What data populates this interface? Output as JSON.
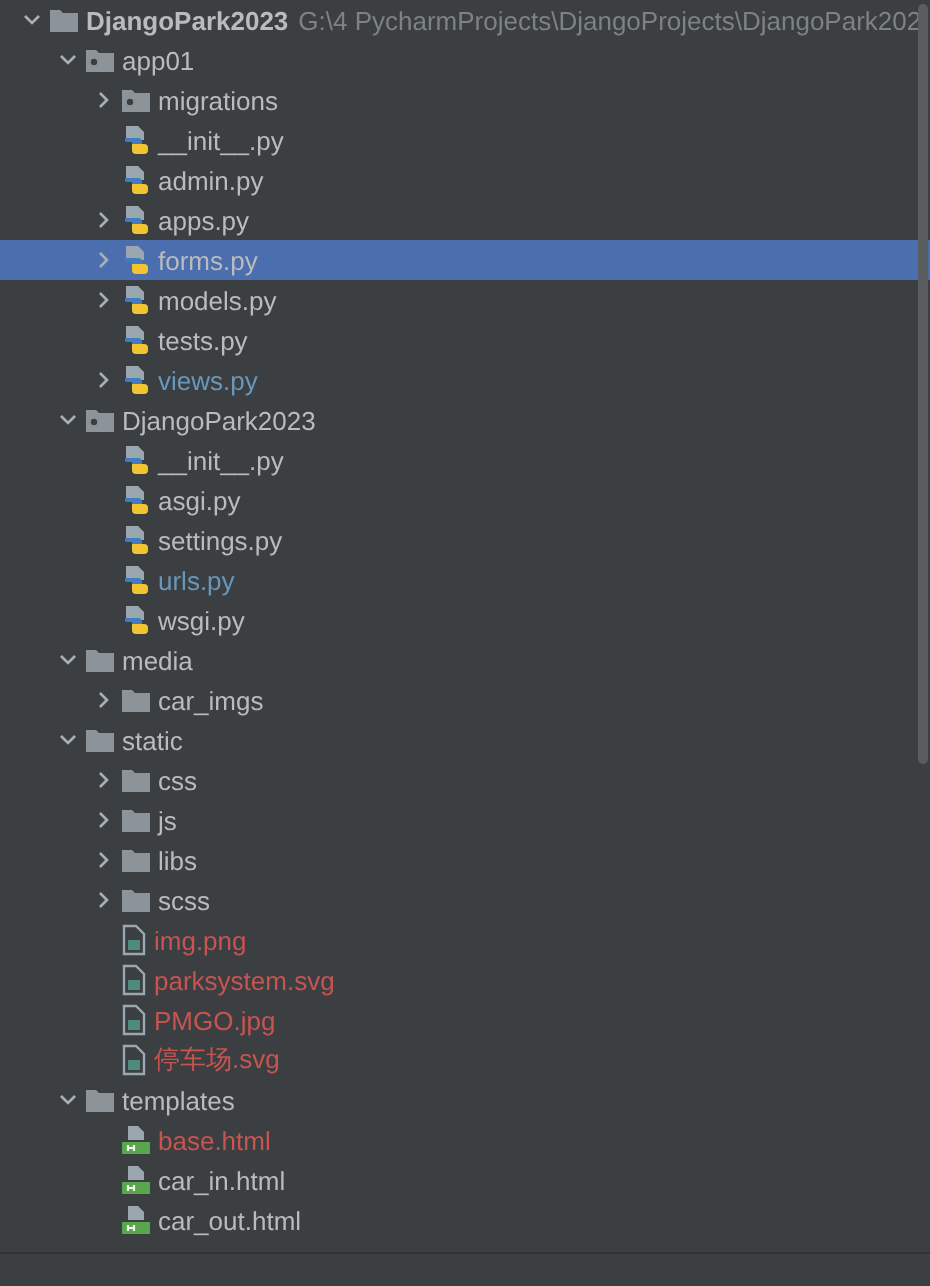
{
  "tree": [
    {
      "name": "DjangoPark2023",
      "path": "G:\\4 PycharmProjects\\DjangoProjects\\DjangoPark202",
      "kind": "folder",
      "expanded": true,
      "selected": false,
      "color": "#bbbbbb",
      "children": [
        {
          "name": "app01",
          "kind": "package",
          "expanded": true,
          "selected": false,
          "color": "#bbbbbb",
          "children": [
            {
              "name": "migrations",
              "kind": "package",
              "expanded": false,
              "selected": false,
              "color": "#bbbbbb"
            },
            {
              "name": "__init__.py",
              "kind": "python",
              "selected": false,
              "color": "#bbbbbb"
            },
            {
              "name": "admin.py",
              "kind": "python",
              "selected": false,
              "color": "#bbbbbb"
            },
            {
              "name": "apps.py",
              "kind": "python",
              "expanded": false,
              "selected": false,
              "color": "#bbbbbb"
            },
            {
              "name": "forms.py",
              "kind": "python",
              "expanded": false,
              "selected": true,
              "color": "#bbbbbb"
            },
            {
              "name": "models.py",
              "kind": "python",
              "expanded": false,
              "selected": false,
              "color": "#bbbbbb"
            },
            {
              "name": "tests.py",
              "kind": "python",
              "selected": false,
              "color": "#bbbbbb"
            },
            {
              "name": "views.py",
              "kind": "python",
              "expanded": false,
              "selected": false,
              "color": "#6897bb"
            }
          ]
        },
        {
          "name": "DjangoPark2023",
          "kind": "package",
          "expanded": true,
          "selected": false,
          "color": "#bbbbbb",
          "children": [
            {
              "name": "__init__.py",
              "kind": "python",
              "selected": false,
              "color": "#bbbbbb"
            },
            {
              "name": "asgi.py",
              "kind": "python",
              "selected": false,
              "color": "#bbbbbb"
            },
            {
              "name": "settings.py",
              "kind": "python",
              "selected": false,
              "color": "#bbbbbb"
            },
            {
              "name": "urls.py",
              "kind": "python",
              "selected": false,
              "color": "#6897bb"
            },
            {
              "name": "wsgi.py",
              "kind": "python",
              "selected": false,
              "color": "#bbbbbb"
            }
          ]
        },
        {
          "name": "media",
          "kind": "folder",
          "expanded": true,
          "selected": false,
          "color": "#bbbbbb",
          "children": [
            {
              "name": "car_imgs",
              "kind": "folder",
              "expanded": false,
              "selected": false,
              "color": "#bbbbbb"
            }
          ]
        },
        {
          "name": "static",
          "kind": "folder",
          "expanded": true,
          "selected": false,
          "color": "#bbbbbb",
          "children": [
            {
              "name": "css",
              "kind": "folder",
              "expanded": false,
              "selected": false,
              "color": "#bbbbbb"
            },
            {
              "name": "js",
              "kind": "folder",
              "expanded": false,
              "selected": false,
              "color": "#bbbbbb"
            },
            {
              "name": "libs",
              "kind": "folder",
              "expanded": false,
              "selected": false,
              "color": "#bbbbbb"
            },
            {
              "name": "scss",
              "kind": "folder",
              "expanded": false,
              "selected": false,
              "color": "#bbbbbb"
            },
            {
              "name": "img.png",
              "kind": "image",
              "selected": false,
              "color": "#c75450"
            },
            {
              "name": "parksystem.svg",
              "kind": "image",
              "selected": false,
              "color": "#c75450"
            },
            {
              "name": "PMGO.jpg",
              "kind": "image",
              "selected": false,
              "color": "#c75450"
            },
            {
              "name": "停车场.svg",
              "kind": "image",
              "selected": false,
              "color": "#c75450"
            }
          ]
        },
        {
          "name": "templates",
          "kind": "folder",
          "expanded": true,
          "selected": false,
          "color": "#bbbbbb",
          "children": [
            {
              "name": "base.html",
              "kind": "html",
              "selected": false,
              "color": "#c75450"
            },
            {
              "name": "car_in.html",
              "kind": "html",
              "selected": false,
              "color": "#bbbbbb"
            },
            {
              "name": "car_out.html",
              "kind": "html",
              "selected": false,
              "color": "#bbbbbb"
            }
          ]
        }
      ]
    }
  ]
}
